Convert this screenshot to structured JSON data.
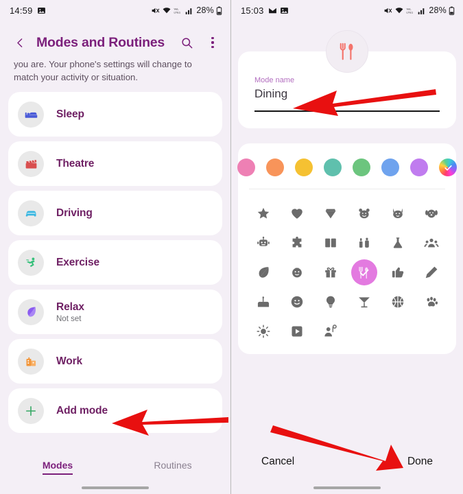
{
  "left_screen": {
    "status_bar": {
      "time": "14:59",
      "battery": "28%",
      "icons": [
        "image-icon",
        "mute-icon",
        "wifi-icon",
        "volte-icon",
        "signal-icon",
        "battery-icon"
      ]
    },
    "header": {
      "back_icon": "chevron-left-icon",
      "title": "Modes and Routines",
      "search_icon": "search-icon",
      "more_icon": "overflow-menu-icon"
    },
    "subtitle": "you are. Your phone's settings will change to match your activity or situation.",
    "modes": [
      {
        "name": "Sleep",
        "sub": "",
        "icon": "bed-icon",
        "color": "#4a5bd8"
      },
      {
        "name": "Theatre",
        "sub": "",
        "icon": "clapperboard-icon",
        "color": "#d94f4f"
      },
      {
        "name": "Driving",
        "sub": "",
        "icon": "car-icon",
        "color": "#3ab6e0"
      },
      {
        "name": "Exercise",
        "sub": "",
        "icon": "runner-icon",
        "color": "#35c07a"
      },
      {
        "name": "Relax",
        "sub": "Not set",
        "icon": "leaf-icon",
        "color": "#8b5cf0"
      },
      {
        "name": "Work",
        "sub": "",
        "icon": "briefcase-building-icon",
        "color": "#f2973c"
      },
      {
        "name": "Add mode",
        "sub": "",
        "icon": "plus-icon",
        "color": "#35a864"
      }
    ],
    "tabs": [
      {
        "label": "Modes",
        "active": true
      },
      {
        "label": "Routines",
        "active": false
      }
    ]
  },
  "right_screen": {
    "status_bar": {
      "time": "15:03",
      "battery": "28%",
      "icons": [
        "gmail-icon",
        "image-icon",
        "mute-icon",
        "wifi-icon",
        "volte-icon",
        "signal-icon",
        "battery-icon"
      ]
    },
    "avatar_icon": "fork-spoon-icon",
    "name_field": {
      "label": "Mode name",
      "value": "Dining"
    },
    "colors": {
      "swatches": [
        "#ee80b4",
        "#f8945a",
        "#f5c132",
        "#5fc0ad",
        "#6cc57e",
        "#6fa3ee",
        "#c07cef",
        "rainbow"
      ],
      "selected_index": 7,
      "selected_check": "check-icon"
    },
    "icon_grid": {
      "selected_index": 21,
      "selected_bg": "#e37ae0",
      "icons": [
        "star-icon",
        "heart-icon",
        "diamond-icon",
        "bear-icon",
        "cat-icon",
        "dog-icon",
        "robot-icon",
        "puzzle-icon",
        "book-icon",
        "cosmetics-icon",
        "flask-icon",
        "people-icon",
        "leaf-icon",
        "baby-icon",
        "gift-icon",
        "fork-spoon-icon",
        "thumbs-up-icon",
        "pencil-icon",
        "cake-icon",
        "smiley-icon",
        "lightbulb-icon",
        "cocktail-icon",
        "basketball-icon",
        "paw-icon",
        "sun-icon",
        "play-icon",
        "presenter-icon"
      ]
    },
    "buttons": {
      "cancel": "Cancel",
      "done": "Done"
    }
  },
  "annotations": {
    "color": "#e81010",
    "arrows": [
      "arrow-to-mode-name",
      "arrow-to-add-mode",
      "arrow-to-done"
    ]
  }
}
